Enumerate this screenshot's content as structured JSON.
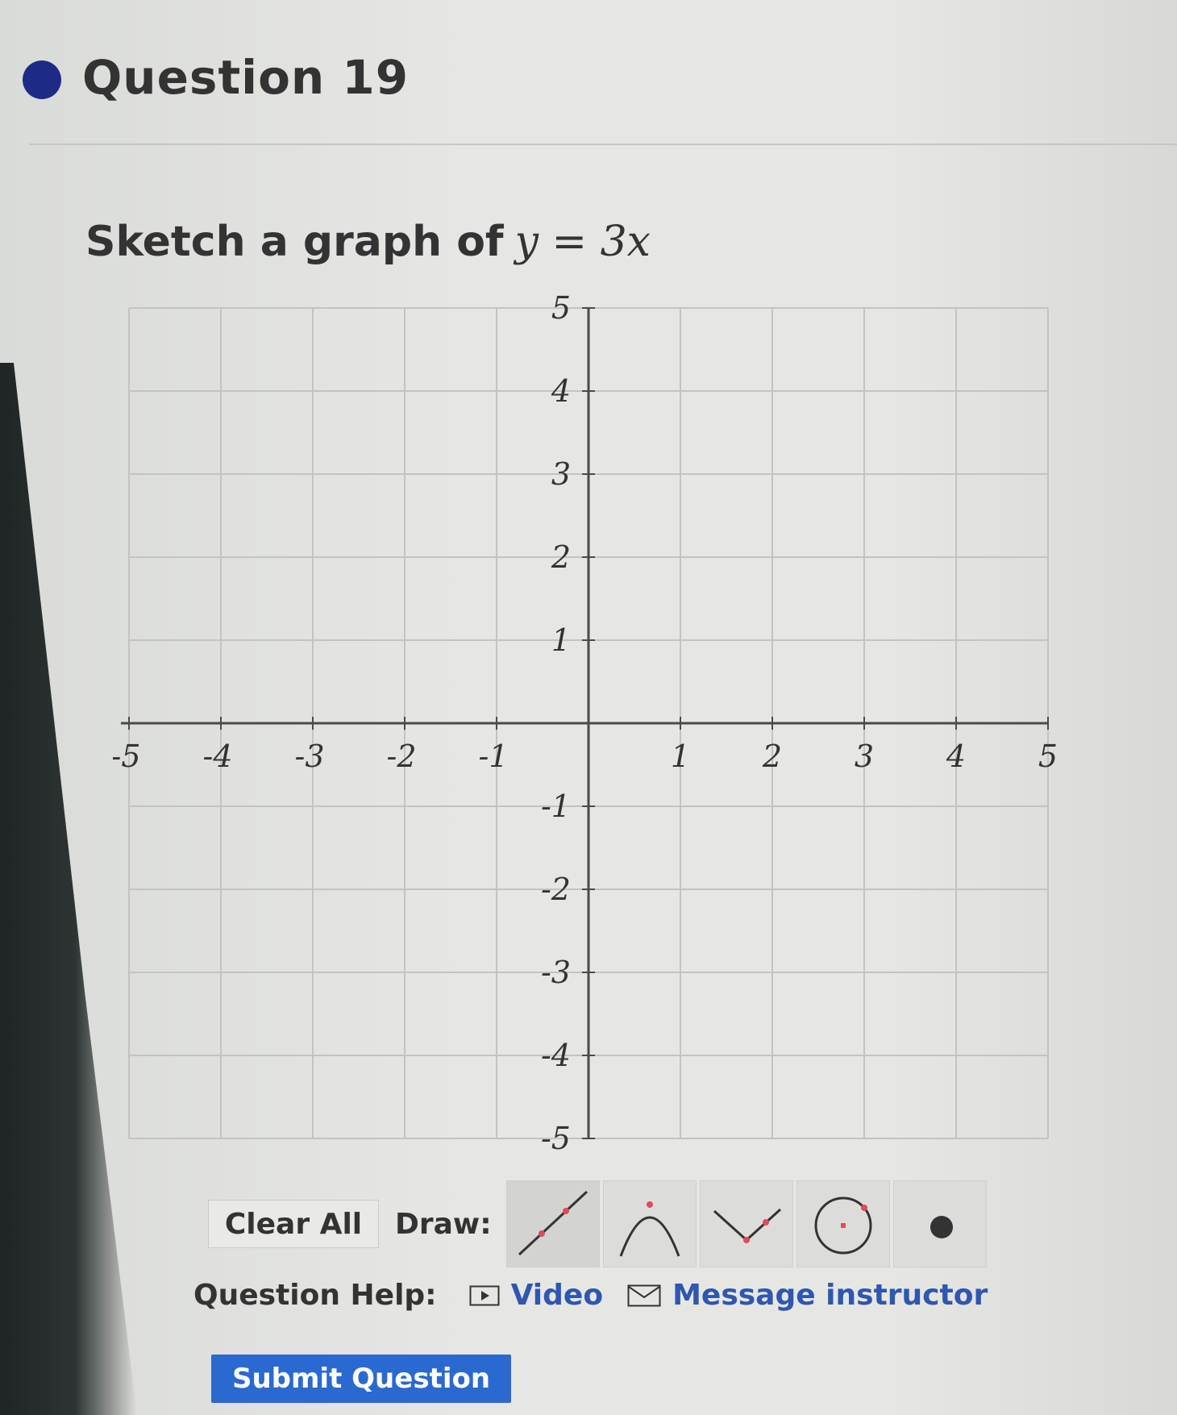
{
  "question": {
    "title": "Question 19",
    "prompt_text": "Sketch a graph of",
    "prompt_math": "y = 3x"
  },
  "graph": {
    "x_tick_labels": [
      "-5",
      "-4",
      "-3",
      "-2",
      "-1",
      "1",
      "2",
      "3",
      "4",
      "5"
    ],
    "y_tick_labels": [
      "5",
      "4",
      "3",
      "2",
      "1",
      "-1",
      "-2",
      "-3",
      "-4",
      "-5"
    ],
    "x_range": [
      -5,
      5
    ],
    "y_range": [
      -5,
      5
    ],
    "grid": true
  },
  "toolbar": {
    "clear_label": "Clear All",
    "draw_label": "Draw:",
    "tools": [
      "line-tool-icon",
      "parabola-tool-icon",
      "absolute-value-tool-icon",
      "circle-tool-icon",
      "point-tool-icon"
    ]
  },
  "help": {
    "label": "Question Help:",
    "video_label": "Video",
    "message_label": "Message instructor"
  },
  "submit_label": "Submit Question",
  "colors": {
    "accent_blue": "#2a69cf",
    "link_blue": "#2f56b0",
    "bullet": "#1e2b86",
    "tool_marker": "#e04a5a"
  }
}
